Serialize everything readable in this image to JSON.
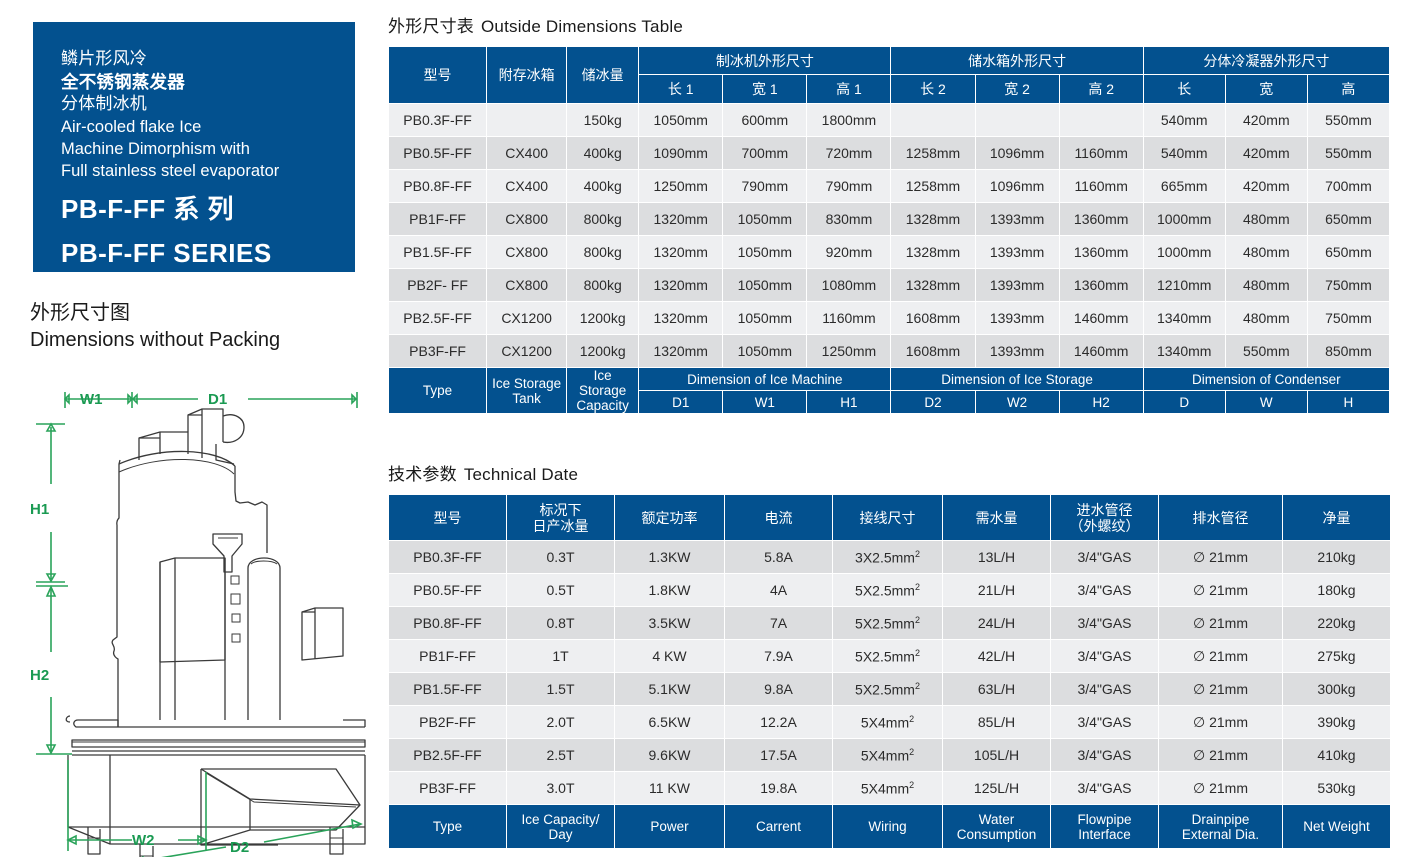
{
  "hero": {
    "cn_line1": "鳞片形风冷",
    "cn_line2": "全不锈钢蒸发器",
    "cn_line3": "分体制冰机",
    "en_line1": "Air-cooled flake Ice",
    "en_line2": "Machine Dimorphism with",
    "en_line3": "Full stainless steel evaporator",
    "series_cn": "PB-F-FF 系    列",
    "series_en": "PB-F-FF SERIES",
    "bg_color": "#03518f"
  },
  "dimensions_section": {
    "title_cn": "外形尺寸图",
    "title_en": "Dimensions without Packing",
    "labels": {
      "w1": "W1",
      "d1": "D1",
      "h1": "H1",
      "h2": "H2",
      "d2": "D2",
      "w2": "W2"
    },
    "label_color": "#1a9a52"
  },
  "table1": {
    "title_cn": "外形尺寸表",
    "title_en": "Outside Dimensions Table",
    "header_groups": [
      {
        "label": "型号",
        "rowspan": 2
      },
      {
        "label": "附存冰箱",
        "rowspan": 2
      },
      {
        "label": "储冰量",
        "rowspan": 2
      },
      {
        "label": "制冰机外形尺寸",
        "colspan": 3
      },
      {
        "label": "储水箱外形尺寸",
        "colspan": 3
      },
      {
        "label": "分体冷凝器外形尺寸",
        "colspan": 3
      }
    ],
    "header_sub": [
      "长 1",
      "宽 1",
      "高 1",
      "长 2",
      "宽 2",
      "高 2",
      "长",
      "宽",
      "高"
    ],
    "rows": [
      [
        "PB0.3F-FF",
        "",
        "150kg",
        "1050mm",
        "600mm",
        "1800mm",
        "",
        "",
        "",
        "540mm",
        "420mm",
        "550mm"
      ],
      [
        "PB0.5F-FF",
        "CX400",
        "400kg",
        "1090mm",
        "700mm",
        "720mm",
        "1258mm",
        "1096mm",
        "1160mm",
        "540mm",
        "420mm",
        "550mm"
      ],
      [
        "PB0.8F-FF",
        "CX400",
        "400kg",
        "1250mm",
        "790mm",
        "790mm",
        "1258mm",
        "1096mm",
        "1160mm",
        "665mm",
        "420mm",
        "700mm"
      ],
      [
        "PB1F-FF",
        "CX800",
        "800kg",
        "1320mm",
        "1050mm",
        "830mm",
        "1328mm",
        "1393mm",
        "1360mm",
        "1000mm",
        "480mm",
        "650mm"
      ],
      [
        "PB1.5F-FF",
        "CX800",
        "800kg",
        "1320mm",
        "1050mm",
        "920mm",
        "1328mm",
        "1393mm",
        "1360mm",
        "1000mm",
        "480mm",
        "650mm"
      ],
      [
        "PB2F- FF",
        "CX800",
        "800kg",
        "1320mm",
        "1050mm",
        "1080mm",
        "1328mm",
        "1393mm",
        "1360mm",
        "1210mm",
        "480mm",
        "750mm"
      ],
      [
        "PB2.5F-FF",
        "CX1200",
        "1200kg",
        "1320mm",
        "1050mm",
        "1160mm",
        "1608mm",
        "1393mm",
        "1460mm",
        "1340mm",
        "480mm",
        "750mm"
      ],
      [
        "PB3F-FF",
        "CX1200",
        "1200kg",
        "1320mm",
        "1050mm",
        "1250mm",
        "1608mm",
        "1393mm",
        "1460mm",
        "1340mm",
        "550mm",
        "850mm"
      ]
    ],
    "footer_groups": [
      {
        "label": "Type",
        "rowspan": 2
      },
      {
        "label": "Ice Storage Tank",
        "rowspan": 2
      },
      {
        "label": "Ice Storage Capacity",
        "rowspan": 2
      },
      {
        "label": "Dimension of Ice Machine",
        "colspan": 3
      },
      {
        "label": "Dimension of Ice Storage",
        "colspan": 3
      },
      {
        "label": "Dimension of Condenser",
        "colspan": 3
      }
    ],
    "footer_sub": [
      "D1",
      "W1",
      "H1",
      "D2",
      "W2",
      "H2",
      "D",
      "W",
      "H"
    ]
  },
  "table2": {
    "title_cn": "技术参数",
    "title_en": "Technical Date",
    "headers": [
      "型号",
      "标况下\n日产冰量",
      "额定功率",
      "电流",
      "接线尺寸",
      "需水量",
      "进水管径\n（外螺纹）",
      "排水管径",
      "净量"
    ],
    "headers_parts": [
      [
        "型号"
      ],
      [
        "标况下",
        "日产冰量"
      ],
      [
        "额定功率"
      ],
      [
        "电流"
      ],
      [
        "接线尺寸"
      ],
      [
        "需水量"
      ],
      [
        "进水管径",
        "（外螺纹）"
      ],
      [
        "排水管径"
      ],
      [
        "净量"
      ]
    ],
    "rows": [
      [
        "PB0.3F-FF",
        "0.3T",
        "1.3KW",
        "5.8A",
        "3X2.5mm2",
        "13L/H",
        "3/4\"GAS",
        "∅ 21mm",
        "210kg"
      ],
      [
        "PB0.5F-FF",
        "0.5T",
        "1.8KW",
        "4A",
        "5X2.5mm2",
        "21L/H",
        "3/4\"GAS",
        "∅ 21mm",
        "180kg"
      ],
      [
        "PB0.8F-FF",
        "0.8T",
        "3.5KW",
        "7A",
        "5X2.5mm2",
        "24L/H",
        "3/4\"GAS",
        "∅ 21mm",
        "220kg"
      ],
      [
        "PB1F-FF",
        "1T",
        "4 KW",
        "7.9A",
        "5X2.5mm2",
        "42L/H",
        "3/4\"GAS",
        "∅ 21mm",
        "275kg"
      ],
      [
        "PB1.5F-FF",
        "1.5T",
        "5.1KW",
        "9.8A",
        "5X2.5mm2",
        "63L/H",
        "3/4\"GAS",
        "∅ 21mm",
        "300kg"
      ],
      [
        "PB2F-FF",
        "2.0T",
        "6.5KW",
        "12.2A",
        "5X4mm2",
        "85L/H",
        "3/4\"GAS",
        "∅ 21mm",
        "390kg"
      ],
      [
        "PB2.5F-FF",
        "2.5T",
        "9.6KW",
        "17.5A",
        "5X4mm2",
        "105L/H",
        "3/4\"GAS",
        "∅ 21mm",
        "410kg"
      ],
      [
        "PB3F-FF",
        "3.0T",
        "11 KW",
        "19.8A",
        "5X4mm2",
        "125L/H",
        "3/4\"GAS",
        "∅ 21mm",
        "530kg"
      ]
    ],
    "footers_parts": [
      [
        "Type"
      ],
      [
        "Ice Capacity/",
        "Day"
      ],
      [
        "Power"
      ],
      [
        "Carrent"
      ],
      [
        "Wiring"
      ],
      [
        "Water",
        "Consumption"
      ],
      [
        "Flowpipe",
        "Interface"
      ],
      [
        "Drainpipe",
        "External Dia."
      ],
      [
        "Net Weight"
      ]
    ]
  },
  "colors": {
    "header_blue": "#03518f",
    "row_light": "#eeeff1",
    "row_dark": "#dcdddf",
    "dim_green": "#1a9a52"
  }
}
